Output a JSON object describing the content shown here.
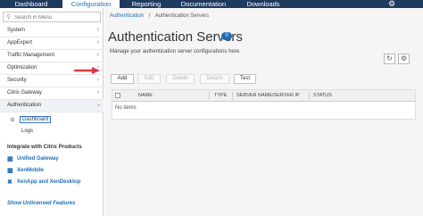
{
  "topnav": {
    "tabs": [
      {
        "label": "Dashboard"
      },
      {
        "label": "Configuration"
      },
      {
        "label": "Reporting"
      },
      {
        "label": "Documentation"
      },
      {
        "label": "Downloads"
      }
    ],
    "active_tab": "Configuration",
    "settings_icon": "gear-icon"
  },
  "sidebar": {
    "search_placeholder": "Search in Menu",
    "items": [
      {
        "label": "System"
      },
      {
        "label": "AppExpert"
      },
      {
        "label": "Traffic Management"
      },
      {
        "label": "Optimization"
      },
      {
        "label": "Security"
      },
      {
        "label": "Citrix Gateway"
      },
      {
        "label": "Authentication"
      }
    ],
    "sub_items": [
      {
        "label": "Dashboard"
      },
      {
        "label": "Logs"
      }
    ],
    "integrate_heading": "Integrate with Citrix Products",
    "products": [
      {
        "label": "Unified Gateway"
      },
      {
        "label": "XenMobile"
      },
      {
        "label": "XenApp and XenDesktop"
      }
    ],
    "show_unlicensed": "Show Unlicensed Features"
  },
  "main": {
    "breadcrumb": {
      "parent": "Authentication",
      "separator": "/",
      "current": "Authentication Servers"
    },
    "title": "Authentication Servers",
    "count": "0",
    "subtitle": "Manage your authentication server configurations here.",
    "toolbar": {
      "add": "Add",
      "edit": "Edit",
      "delete": "Delete",
      "details": "Details",
      "test": "Test"
    },
    "table": {
      "columns": [
        "NAME",
        "TYPE",
        "SERVER NAME/SERVER IP",
        "STATUS"
      ],
      "empty_text": "No items"
    }
  },
  "colors": {
    "topnav_bg": "#1f3a5f",
    "accent": "#1f6eb3",
    "arrow": "#e0393e"
  }
}
